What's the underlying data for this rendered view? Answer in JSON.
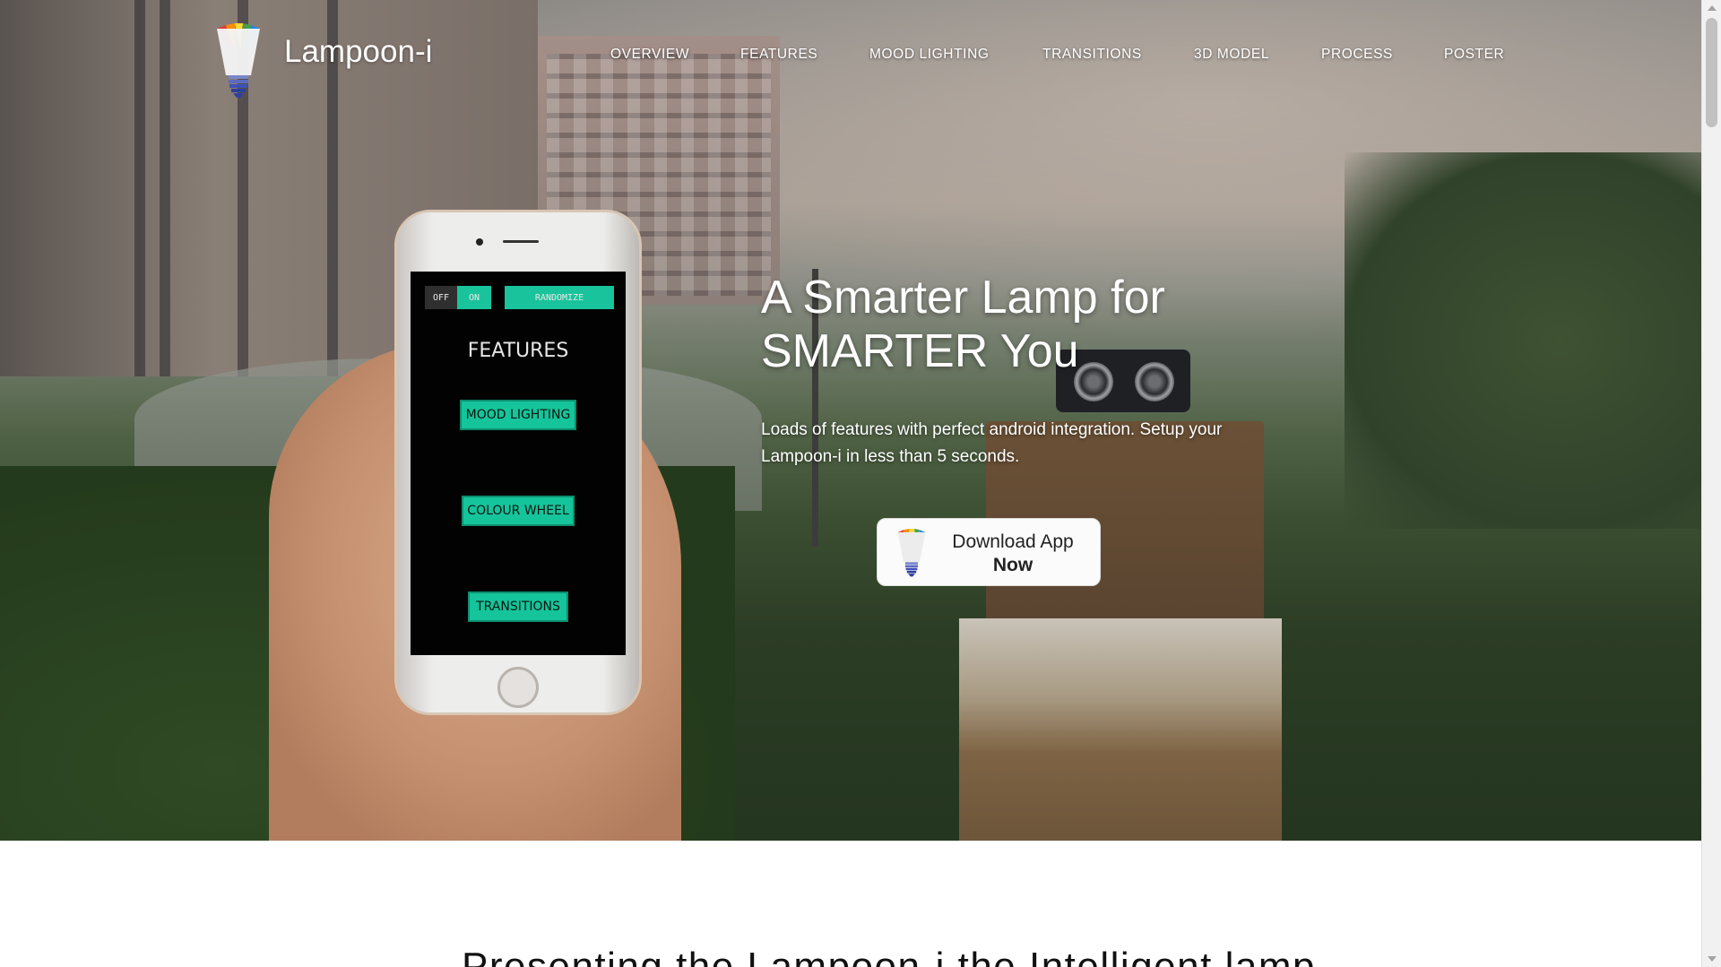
{
  "brand": {
    "name": "Lampoon-i",
    "logo_icon": "rainbow-bulb-icon"
  },
  "nav": {
    "items": [
      {
        "label": "OVERVIEW"
      },
      {
        "label": "FEATURES"
      },
      {
        "label": "MOOD LIGHTING"
      },
      {
        "label": "TRANSITIONS"
      },
      {
        "label": "3D MODEL"
      },
      {
        "label": "PROCESS"
      },
      {
        "label": "POSTER"
      }
    ]
  },
  "hero": {
    "headline_line1": "A Smarter Lamp for",
    "headline_line2": "SMARTER You",
    "subtext": "Loads of features with perfect android integration. Setup your Lampoon-i in less than 5 seconds.",
    "download_button": {
      "line1": "Download App",
      "line2": "Now",
      "icon": "rainbow-bulb-icon"
    }
  },
  "phone_screen": {
    "toggle_off": "OFF",
    "toggle_on": "ON",
    "randomize": "RANDOMIZE",
    "title": "FEATURES",
    "buttons": [
      "MOOD LIGHTING",
      "COLOUR WHEEL",
      "TRANSITIONS"
    ]
  },
  "section": {
    "title": "Presenting the Lampoon-i the Intelligent lamp"
  },
  "colors": {
    "accent_teal": "#15c49a",
    "nav_text": "#ffffff",
    "button_bg": "#fbfbfb",
    "phone_screen_bg": "#020202"
  },
  "scrollbar": {
    "position_fraction": 0.0
  }
}
